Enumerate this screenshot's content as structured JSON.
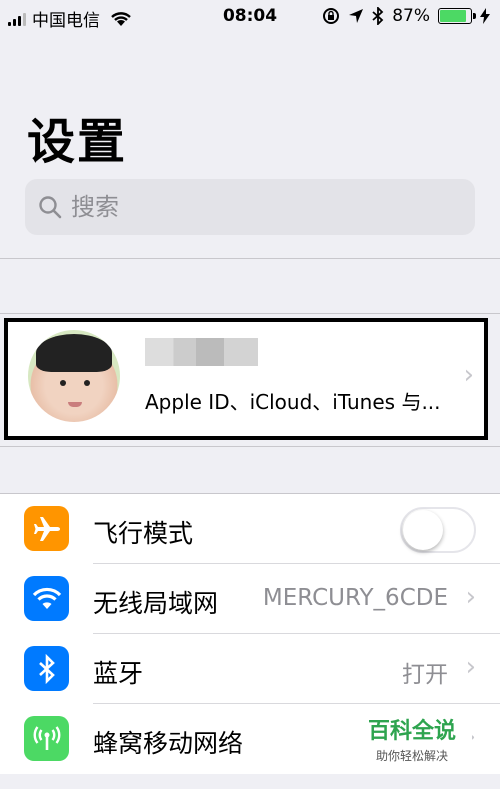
{
  "status_bar": {
    "carrier": "中国电信",
    "time": "08:04",
    "battery_percent": "87%",
    "battery_level": 0.87,
    "icons": [
      "signal-icon",
      "wifi-icon",
      "rotation-lock-icon",
      "location-icon",
      "bluetooth-icon",
      "battery-icon",
      "charging-icon"
    ]
  },
  "page": {
    "title": "设置"
  },
  "search": {
    "placeholder": "搜索"
  },
  "profile": {
    "subtitle": "Apple ID、iCloud、iTunes 与...",
    "name": ""
  },
  "settings": {
    "items": [
      {
        "label": "飞行模式",
        "value": "",
        "icon": "airplane-icon",
        "color": "#ff9500",
        "control": "toggle",
        "toggle_on": false
      },
      {
        "label": "无线局域网",
        "value": "MERCURY_6CDE",
        "icon": "wifi-icon",
        "color": "#007aff",
        "control": "chevron"
      },
      {
        "label": "蓝牙",
        "value": "打开",
        "icon": "bluetooth-icon",
        "color": "#007aff",
        "control": "chevron"
      },
      {
        "label": "蜂窝移动网络",
        "value": "",
        "icon": "antenna-icon",
        "color": "#4cd964",
        "control": "chevron"
      }
    ]
  },
  "watermark": {
    "title": "百科全说",
    "subtitle": "助你轻松解决"
  },
  "colors": {
    "background": "#efeff4",
    "separator": "#c8c7cc",
    "accent": "#007aff",
    "battery": "#4cd964",
    "chevron": "#c7c7cc"
  }
}
